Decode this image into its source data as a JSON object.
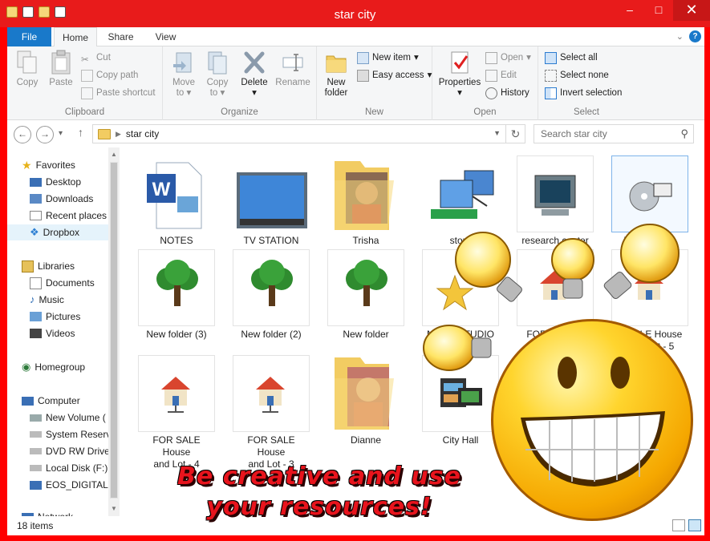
{
  "window": {
    "title": "star city",
    "buttons": [
      "minimize",
      "maximize",
      "close"
    ]
  },
  "ribbon_tabs": [
    "File",
    "Home",
    "Share",
    "View"
  ],
  "ribbon": {
    "clipboard": {
      "name": "Clipboard",
      "copy": "Copy",
      "paste": "Paste",
      "cut": "Cut",
      "copy_path": "Copy path",
      "paste_shortcut": "Paste shortcut"
    },
    "organize": {
      "name": "Organize",
      "move_to": "Move",
      "move_to_2": "to",
      "copy_to": "Copy",
      "copy_to_2": "to",
      "delete": "Delete",
      "rename": "Rename"
    },
    "new": {
      "name": "New",
      "new_folder": "New",
      "new_folder_2": "folder",
      "new_item": "New item",
      "easy_access": "Easy access"
    },
    "open": {
      "name": "Open",
      "properties": "Properties",
      "open": "Open",
      "edit": "Edit",
      "history": "History"
    },
    "select": {
      "name": "Select",
      "select_all": "Select all",
      "select_none": "Select none",
      "invert": "Invert selection"
    }
  },
  "address": {
    "path": "star city",
    "search_placeholder": "Search star city"
  },
  "nav": {
    "favorites": "Favorites",
    "favorite_items": [
      "Desktop",
      "Downloads",
      "Recent places",
      "Dropbox"
    ],
    "libraries": "Libraries",
    "library_items": [
      "Documents",
      "Music",
      "Pictures",
      "Videos"
    ],
    "homegroup": "Homegroup",
    "computer": "Computer",
    "computer_items": [
      "New Volume (",
      "System Reserv",
      "DVD RW Drive",
      "Local Disk (F:)",
      "EOS_DIGITAL ("
    ],
    "network": "Network"
  },
  "files": [
    {
      "name": "NOTES",
      "icon": "word-document-icon"
    },
    {
      "name": "TV STATION",
      "icon": "monitor-icon"
    },
    {
      "name": "Trisha",
      "icon": "photo-folder-icon"
    },
    {
      "name": "store",
      "icon": "network-computers-icon"
    },
    {
      "name": "research center",
      "icon": "computer-monitor-icon"
    },
    {
      "name": "M",
      "name_tail": "O",
      "icon": "cd-music-icon"
    },
    {
      "name": "New folder (3)",
      "icon": "tree-icon"
    },
    {
      "name": "New folder (2)",
      "icon": "tree-icon"
    },
    {
      "name": "New folder",
      "icon": "tree-icon"
    },
    {
      "name": "N",
      "name_tail": "STUDIO",
      "icon": "star-icon"
    },
    {
      "name": "FOR SALE H",
      "icon": "house-network-icon"
    },
    {
      "name": "R SALE House",
      "name_2": "t - 5",
      "icon": "house-network-icon"
    },
    {
      "name": "FOR SALE House",
      "name_2": "and Lot - 4",
      "icon": "house-network-icon"
    },
    {
      "name": "FOR SALE House",
      "name_2": "and Lot - 3",
      "icon": "house-network-icon"
    },
    {
      "name": "Dianne",
      "icon": "photo-folder-icon"
    },
    {
      "name": "City Hall",
      "icon": "film-icon"
    }
  ],
  "status": {
    "items": "18 items"
  },
  "overlay": {
    "line1": "Be creative and use",
    "line2": "your resources!"
  },
  "colors": {
    "accent": "#1979ca",
    "frame": "#e81b1b",
    "banner": "#e8141d"
  }
}
